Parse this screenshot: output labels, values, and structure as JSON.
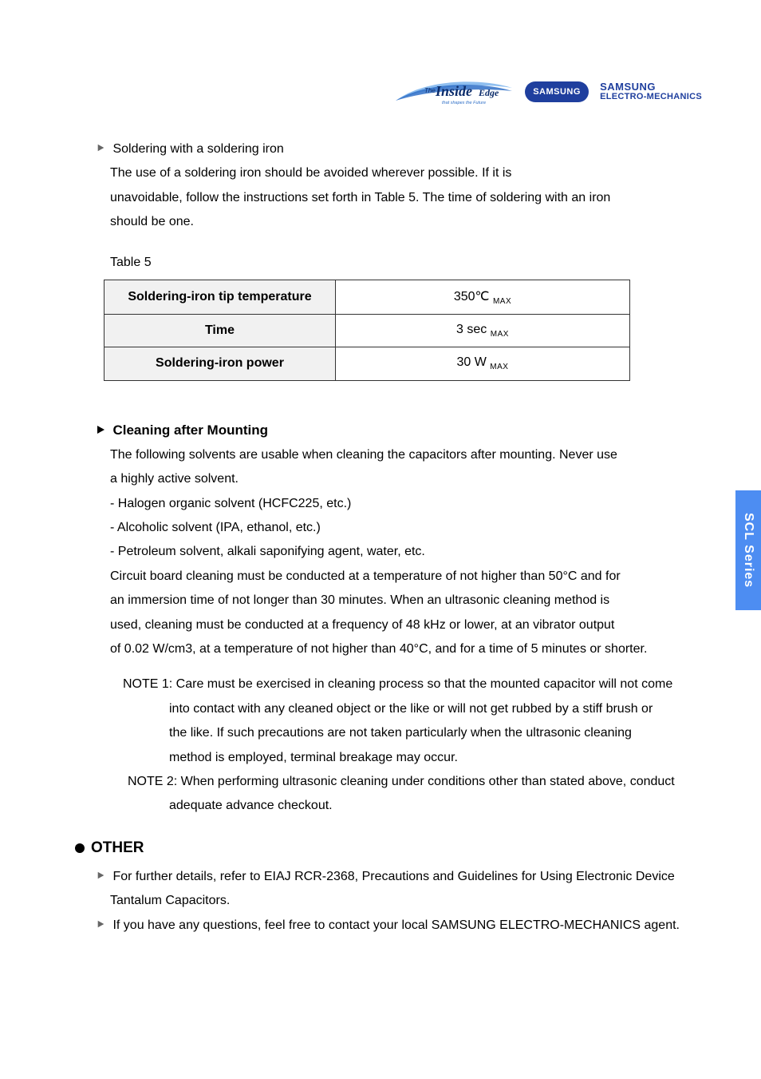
{
  "header": {
    "logo_inside_prefix": "The",
    "logo_inside_main": "Inside",
    "logo_inside_suffix": "Edge",
    "logo_inside_tag": "that shapes the Future",
    "logo_samsung": "SAMSUNG",
    "logo_sem_l1": "SAMSUNG",
    "logo_sem_l2": "ELECTRO-MECHANICS"
  },
  "side_tab": "SCL Series",
  "soldering": {
    "title": "Soldering with a soldering iron",
    "para1a": "The use of a soldering iron should be avoided wherever possible. If it is",
    "para1b": "unavoidable, follow the instructions set forth in Table 5. The time of soldering with  an iron",
    "para1c": "should be one.",
    "table_caption": "Table 5",
    "table": {
      "r1_label": "Soldering-iron tip temperature",
      "r1_val": "350",
      "r1_unit": "℃",
      "r1_sub": "MAX",
      "r2_label": "Time",
      "r2_val": "3 sec",
      "r2_sub": "MAX",
      "r3_label": "Soldering-iron power",
      "r3_val": "30 W",
      "r3_sub": "MAX"
    }
  },
  "cleaning": {
    "title": "Cleaning after Mounting",
    "p1a": "The following solvents are usable when cleaning the capacitors after mounting. Never use",
    "p1b": " a highly active solvent.",
    "b1": " - Halogen organic solvent (HCFC225, etc.)",
    "b2": " - Alcoholic solvent (IPA, ethanol, etc.)",
    "b3": " - Petroleum solvent, alkali saponifying agent, water, etc.",
    "p2a": "Circuit board cleaning must be conducted at a temperature of not higher than 50°C and for",
    "p2b": "an immersion time of not longer than 30 minutes. When an ultrasonic cleaning method is",
    "p2c": "used, cleaning must be conducted at a frequency of 48 kHz or lower, at an vibrator output",
    "p2d": "of 0.02 W/cm3, at a temperature of not higher than 40°C, and for a time of 5 minutes or shorter.",
    "n1a": "NOTE 1: Care must be exercised in cleaning process so that the mounted capacitor will not come",
    "n1b": "into contact with any cleaned object or the like or will not get rubbed by a stiff brush or",
    "n1c": "the  like. If such precautions are not taken particularly when the ultrasonic cleaning",
    "n1d": "method is employed, terminal breakage may occur.",
    "n2a": "NOTE 2: When performing ultrasonic cleaning under conditions other than stated above, conduct",
    "n2b": "adequate advance checkout."
  },
  "other": {
    "title": "OTHER",
    "b1a": "For further details, refer to EIAJ RCR-2368, Precautions and Guidelines for Using  Electronic Device",
    "b1b": "Tantalum Capacitors.",
    "b2": "If you have any questions, feel free to contact your local SAMSUNG ELECTRO-MECHANICS agent."
  }
}
